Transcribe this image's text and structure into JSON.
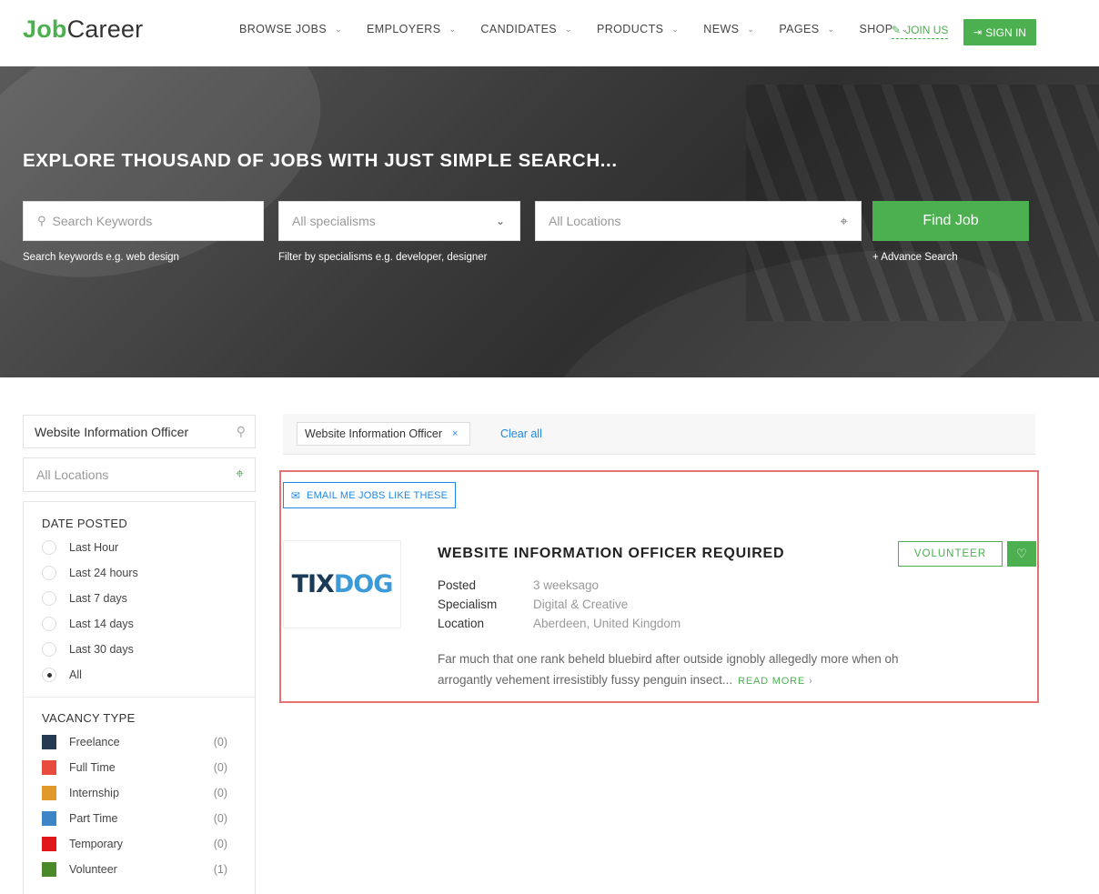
{
  "header": {
    "logo_job": "Job",
    "logo_career": "Career",
    "nav": [
      "BROWSE JOBS",
      "EMPLOYERS",
      "CANDIDATES",
      "PRODUCTS",
      "NEWS",
      "PAGES",
      "SHOP"
    ],
    "join_us": "JOIN US",
    "sign_in": "SIGN IN"
  },
  "hero": {
    "title": "EXPLORE THOUSAND OF JOBS WITH JUST SIMPLE SEARCH...",
    "keywords_placeholder": "Search Keywords",
    "specialisms_value": "All specialisms",
    "locations_placeholder": "All Locations",
    "find_job": "Find Job",
    "hint_keywords": "Search keywords e.g. web design",
    "hint_specialisms": "Filter by specialisms e.g. developer, designer",
    "advance_search": "+ Advance Search"
  },
  "sidebar": {
    "search_value": "Website Information Officer",
    "location_placeholder": "All Locations",
    "date_posted": {
      "title": "DATE POSTED",
      "options": [
        "Last Hour",
        "Last 24 hours",
        "Last 7 days",
        "Last 14 days",
        "Last 30 days",
        "All"
      ],
      "selected": "All"
    },
    "vacancy_type": {
      "title": "VACANCY TYPE",
      "items": [
        {
          "label": "Freelance",
          "count": "(0)",
          "color": "#243b53"
        },
        {
          "label": "Full Time",
          "count": "(0)",
          "color": "#e74c3c"
        },
        {
          "label": "Internship",
          "count": "(0)",
          "color": "#e09a2b"
        },
        {
          "label": "Part Time",
          "count": "(0)",
          "color": "#3d85c6"
        },
        {
          "label": "Temporary",
          "count": "(0)",
          "color": "#e0161b"
        },
        {
          "label": "Volunteer",
          "count": "(1)",
          "color": "#4a8a2a"
        }
      ]
    }
  },
  "filters": {
    "active_tag": "Website Information Officer",
    "remove": "×",
    "clear_all": "Clear all"
  },
  "result": {
    "email_button": "EMAIL ME JOBS LIKE THESE",
    "company_logo_a": "TIX",
    "company_logo_b": "DOG",
    "title": "WEBSITE INFORMATION OFFICER REQUIRED",
    "type_badge": "VOLUNTEER",
    "meta": {
      "posted_label": "Posted",
      "posted_value": "3 weeksago",
      "specialism_label": "Specialism",
      "specialism_value": "Digital & Creative",
      "location_label": "Location",
      "location_value": "Aberdeen, United Kingdom"
    },
    "description": "Far much that one rank beheld bluebird after outside ignobly allegedly more when oh arrogantly vehement irresistibly fussy penguin insect...",
    "read_more": "READ MORE"
  },
  "colors": {
    "brand_green": "#4caf50",
    "link_blue": "#1e88e5",
    "highlight_red": "#e57373"
  }
}
